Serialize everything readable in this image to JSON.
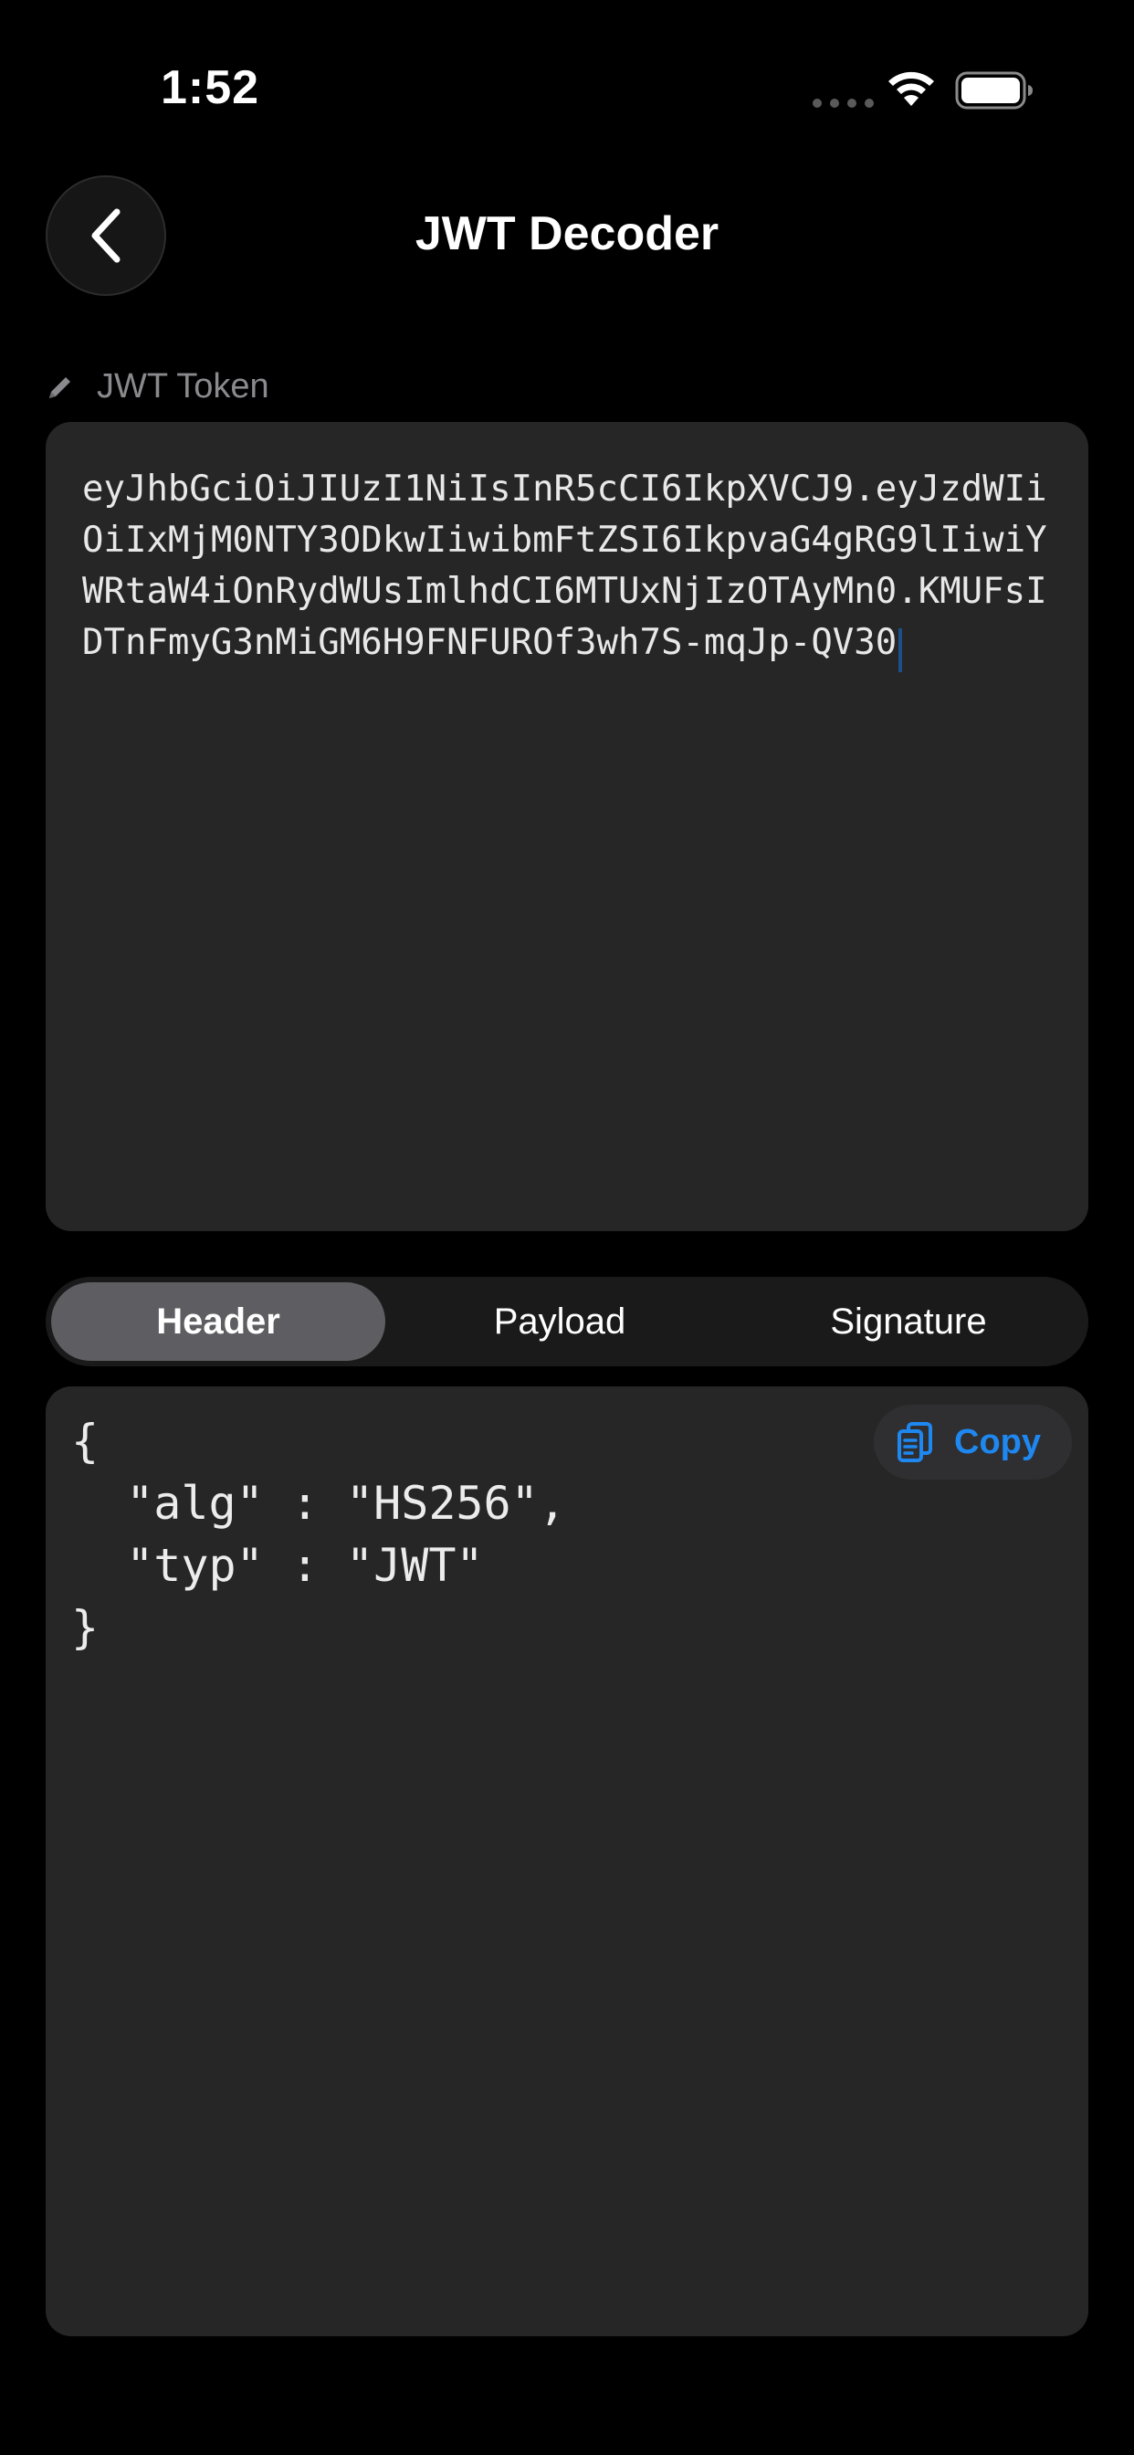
{
  "status_bar": {
    "time": "1:52"
  },
  "nav": {
    "title": "JWT Decoder",
    "back_icon": "chevron-left-icon"
  },
  "token": {
    "label": "JWT Token",
    "label_icon": "pencil-icon",
    "value": "eyJhbGciOiJIUzI1NiIsInR5cCI6IkpXVCJ9.eyJzdWIiOiIxMjM0NTY3ODkwIiwibmFtZSI6IkpvaG4gRG9lIiwiYWRtaW4iOnRydWUsImlhdCI6MTUxNjIzOTAyMn0.KMUFsIDTnFmyG3nMiGM6H9FNFUROf3wh7S-mqJp-QV30"
  },
  "tabs": [
    {
      "label": "Header",
      "active": true
    },
    {
      "label": "Payload",
      "active": false
    },
    {
      "label": "Signature",
      "active": false
    }
  ],
  "output": {
    "copy_label": "Copy",
    "copy_icon": "copy-icon",
    "lines": [
      "{",
      "  \"alg\" : \"HS256\",",
      "  \"typ\" : \"JWT\"",
      "}"
    ]
  },
  "colors": {
    "background": "#000000",
    "surface": "#262626",
    "accent": "#1e88f0",
    "segment_active": "#5e5e62",
    "muted_text": "#8a8a8e"
  }
}
